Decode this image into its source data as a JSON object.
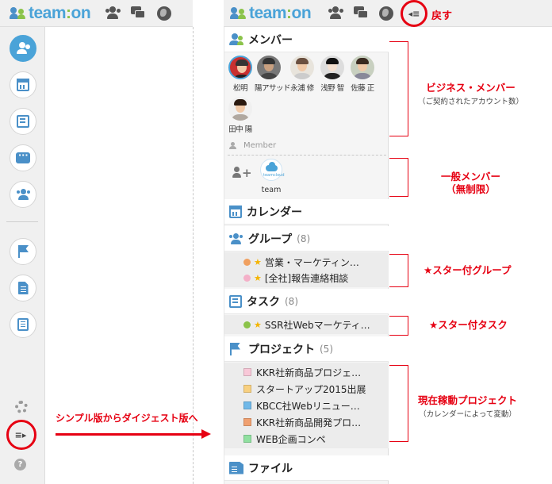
{
  "app": {
    "logo_main": "team",
    "logo_colon": ":",
    "logo_end": "on"
  },
  "left": {
    "annotation": "シンプル版からダイジェスト版へ"
  },
  "right": {
    "back_label": "戻す",
    "sections": {
      "members": {
        "title": "メンバー",
        "users": [
          "松明",
          "陽アサッド",
          "永浦 修",
          "浅野 智",
          "佐藤 正",
          "田中 陽"
        ],
        "member_label": "Member",
        "general_member": "team"
      },
      "calendar": {
        "title": "カレンダー"
      },
      "groups": {
        "title": "グループ",
        "count": "(8)",
        "items": [
          {
            "label": "営業・マーケティン…",
            "color": "#f0a060"
          },
          {
            "label": "[全社]報告連絡相談",
            "color": "#f4b0c8"
          }
        ]
      },
      "tasks": {
        "title": "タスク",
        "count": "(8)",
        "items": [
          {
            "label": "SSR社Webマーケティ…",
            "color": "#8bc34a"
          }
        ]
      },
      "projects": {
        "title": "プロジェクト",
        "count": "(5)",
        "items": [
          {
            "label": "KKR社新商品プロジェ…",
            "color": "#f8c8d8"
          },
          {
            "label": "スタートアップ2015出展",
            "color": "#f8d080"
          },
          {
            "label": "KBCC社Webリニュー…",
            "color": "#70b8e8"
          },
          {
            "label": "KKR社新商品開発プロ…",
            "color": "#f0a070"
          },
          {
            "label": "WEB企画コンペ",
            "color": "#90e0a0"
          }
        ]
      },
      "files": {
        "title": "ファイル"
      }
    },
    "annotations": {
      "business": {
        "title": "ビジネス・メンバー",
        "sub": "（ご契約されたアカウント数）"
      },
      "general": {
        "title1": "一般メンバー",
        "title2": "（無制限）"
      },
      "star_group": "★スター付グループ",
      "star_task": "★スター付タスク",
      "projects": {
        "title": "現在稼動プロジェクト",
        "sub": "（カレンダーによって変動）"
      }
    }
  }
}
